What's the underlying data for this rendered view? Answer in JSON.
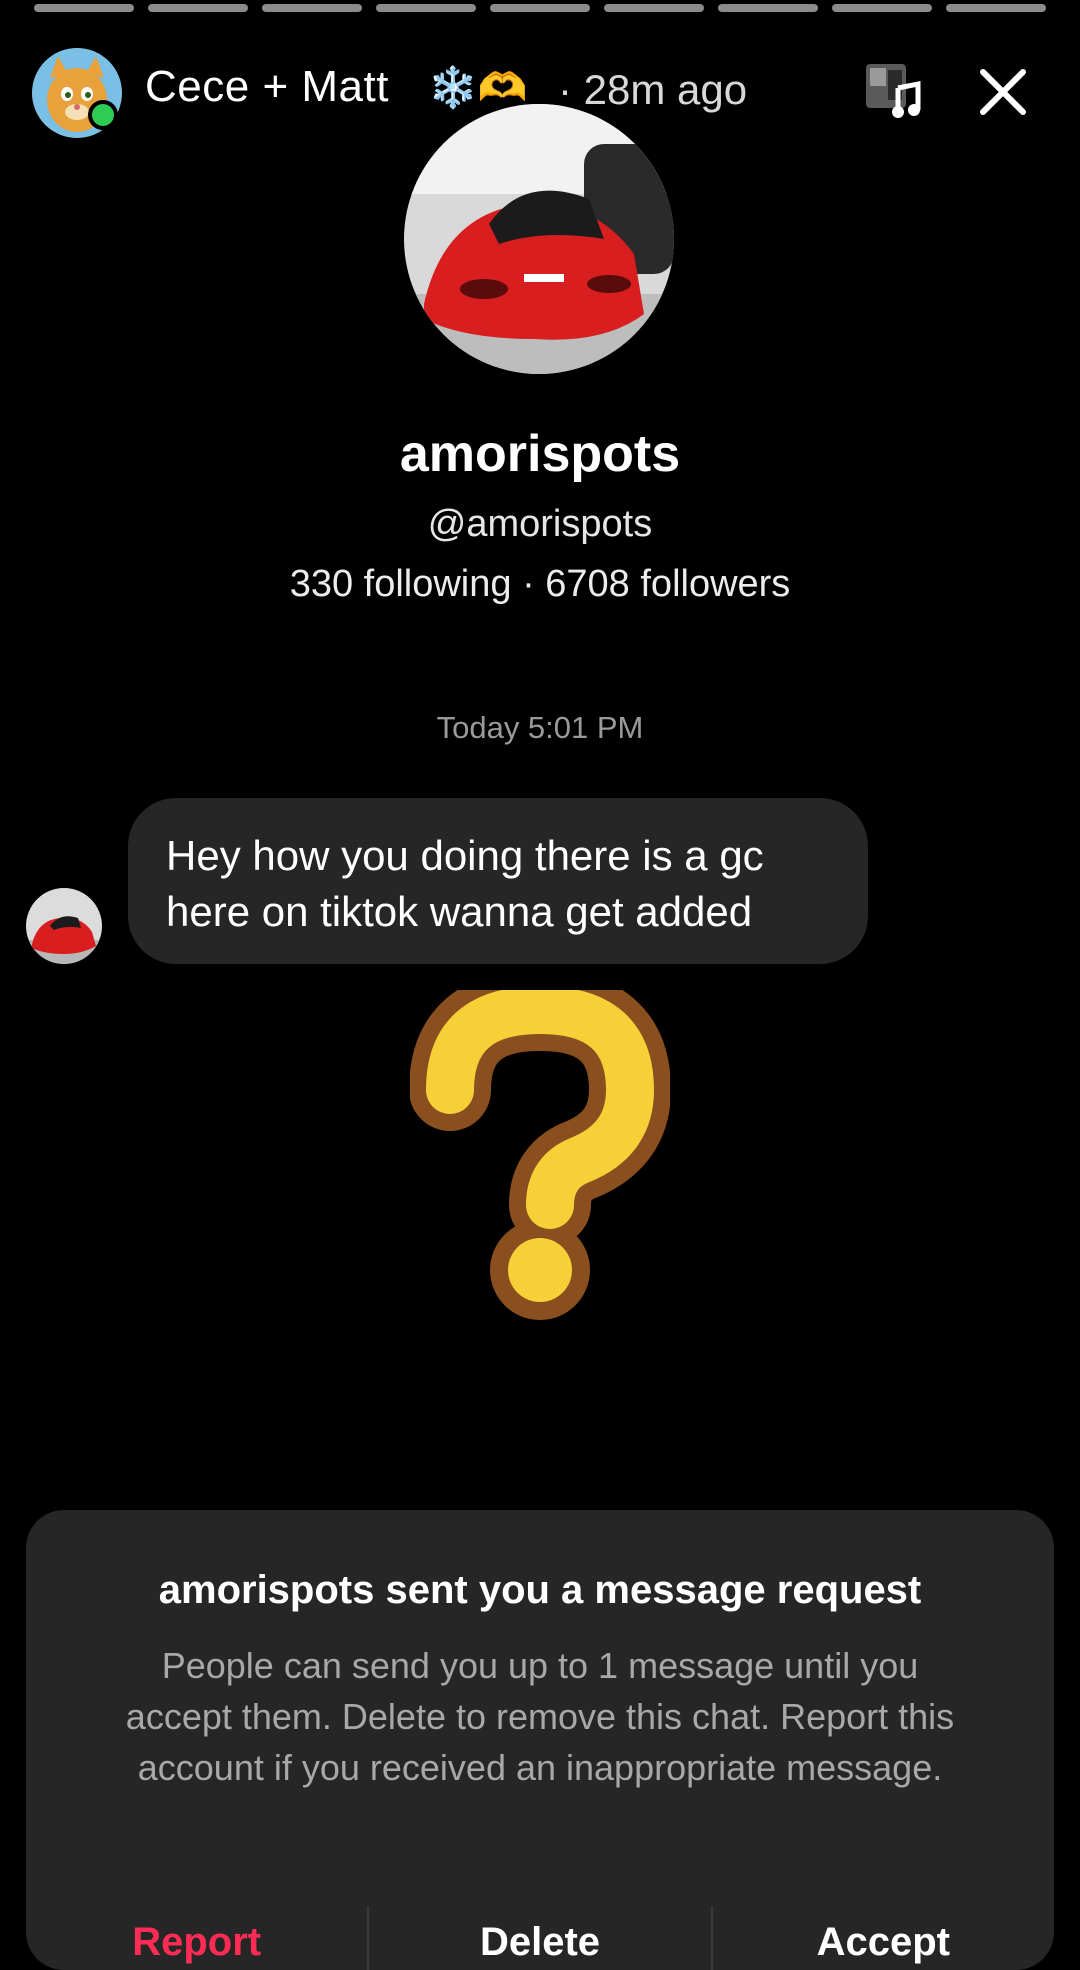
{
  "story": {
    "title": "Cece + Matt",
    "title_emoji": "❄️🫶",
    "time": "· 28m ago",
    "progress_segments": 9
  },
  "profile": {
    "display_name": "amorispots",
    "handle": "@amorispots",
    "stats": "330 following · 6708 followers"
  },
  "chat": {
    "timestamp": "Today 5:01 PM",
    "messages": [
      {
        "text": "Hey how you doing there is a gc here on tiktok wanna get added"
      }
    ]
  },
  "request": {
    "title": "amorispots sent you a message request",
    "body": "People can send you up to 1 message until you accept them. Delete to remove this chat. Report this account if you received an inappropriate message.",
    "actions": [
      {
        "label": "Report",
        "color": "#fe2c55"
      },
      {
        "label": "Delete",
        "color": "#ffffff"
      },
      {
        "label": "Accept",
        "color": "#ffffff"
      }
    ]
  },
  "icons": {
    "close": "close-icon",
    "music": "music-note-icon",
    "sticker": "question-mark-sticker"
  },
  "colors": {
    "background": "#000000",
    "bubble": "#262626",
    "online": "#2ecc55",
    "report": "#fe2c55",
    "sticker_fill": "#f7d038",
    "sticker_outline": "#8a4f1e"
  }
}
